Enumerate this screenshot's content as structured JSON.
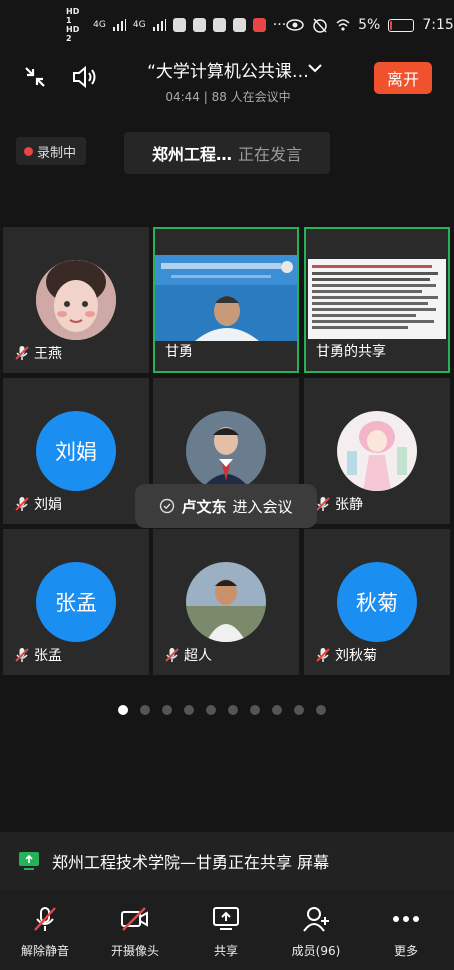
{
  "status_bar": {
    "hd1": "HD 1",
    "hd2": "HD 2",
    "sig1": "4G",
    "sig2": "4G",
    "battery": "5%",
    "time": "7:15"
  },
  "meeting": {
    "title": "“大学计算机公共课…",
    "duration": "04:44",
    "participants_text": "88 人在会议中",
    "leave_label": "离开"
  },
  "recording_label": "录制中",
  "speaker": {
    "name": "郑州工程…",
    "status": "正在发言"
  },
  "tiles": [
    {
      "name": "王燕",
      "avatar_text": "",
      "muted": true,
      "active": false
    },
    {
      "name": "甘勇",
      "avatar_text": "",
      "muted": false,
      "active": true
    },
    {
      "name": "甘勇的共享",
      "avatar_text": "",
      "muted": false,
      "active": true
    },
    {
      "name": "刘娟",
      "avatar_text": "刘娟",
      "muted": true,
      "active": false
    },
    {
      "name": "",
      "avatar_text": "",
      "muted": false,
      "active": false
    },
    {
      "name": "张静",
      "avatar_text": "",
      "muted": true,
      "active": false
    },
    {
      "name": "张孟",
      "avatar_text": "张孟",
      "muted": true,
      "active": false
    },
    {
      "name": "超人",
      "avatar_text": "",
      "muted": true,
      "active": false
    },
    {
      "name": "刘秋菊",
      "avatar_text": "秋菊",
      "muted": true,
      "active": false
    }
  ],
  "toast": {
    "name": "卢文东",
    "text": "进入会议"
  },
  "page_indicator": {
    "total": 10,
    "current": 1
  },
  "share_banner": {
    "text": "郑州工程技术学院—甘勇正在共享 屏幕"
  },
  "toolbar": {
    "unmute": "解除静音",
    "camera": "开摄像头",
    "share": "共享",
    "members": "成员(96)",
    "more": "更多"
  },
  "colors": {
    "background": "#151515",
    "tile": "#2a2a2a",
    "accent_blue": "#1b8ef2",
    "active_border": "#25b35a",
    "leave_button": "#f0522d",
    "record_dot": "#e94545"
  }
}
